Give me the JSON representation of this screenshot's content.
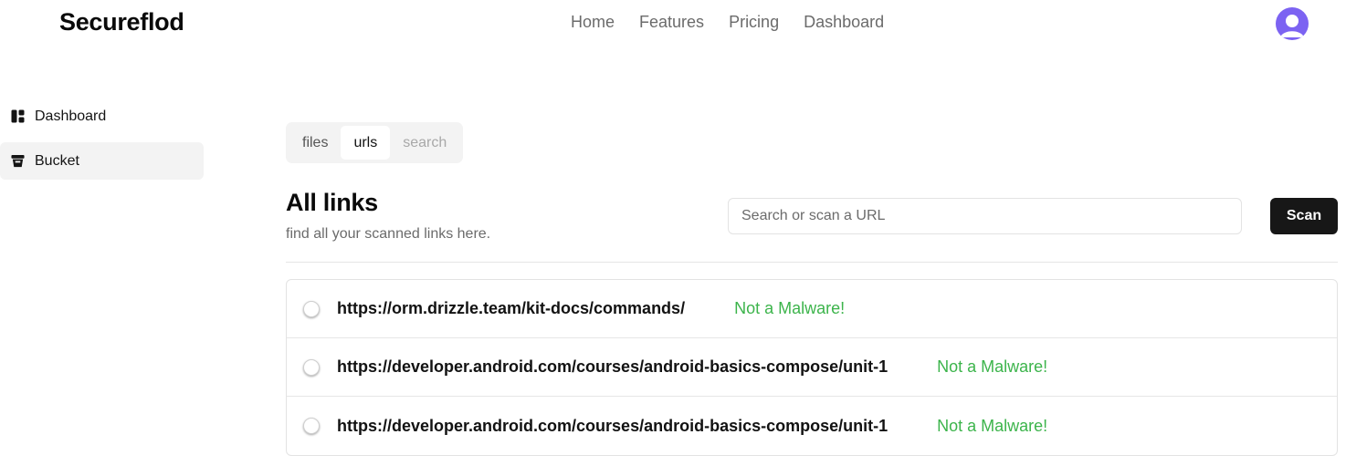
{
  "header": {
    "brand": "Secureflod",
    "nav": [
      "Home",
      "Features",
      "Pricing",
      "Dashboard"
    ],
    "avatar_icon": "user-avatar-icon"
  },
  "sidebar": {
    "items": [
      {
        "label": "Dashboard",
        "icon": "dashboard-icon",
        "active": false
      },
      {
        "label": "Bucket",
        "icon": "bucket-icon",
        "active": true
      }
    ]
  },
  "tabs": [
    {
      "label": "files",
      "state": "normal"
    },
    {
      "label": "urls",
      "state": "active"
    },
    {
      "label": "search",
      "state": "disabled"
    }
  ],
  "main": {
    "title": "All links",
    "subtitle": "find all your scanned links here.",
    "search_placeholder": "Search or scan a URL",
    "scan_label": "Scan"
  },
  "links": [
    {
      "url": "https://orm.drizzle.team/kit-docs/commands/",
      "status": "Not a Malware!"
    },
    {
      "url": "https://developer.android.com/courses/android-basics-compose/unit-1",
      "status": "Not a Malware!"
    },
    {
      "url": "https://developer.android.com/courses/android-basics-compose/unit-1",
      "status": "Not a Malware!"
    }
  ],
  "colors": {
    "accent": "#7c63f2",
    "success": "#3cb44b",
    "primary_button": "#171717"
  }
}
